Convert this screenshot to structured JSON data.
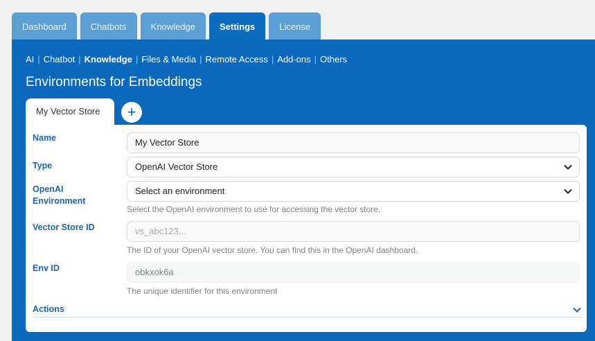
{
  "tabs": [
    {
      "label": "Dashboard",
      "active": false
    },
    {
      "label": "Chatbots",
      "active": false
    },
    {
      "label": "Knowledge",
      "active": false
    },
    {
      "label": "Settings",
      "active": true
    },
    {
      "label": "License",
      "active": false
    }
  ],
  "subnav": [
    {
      "label": "AI",
      "active": false
    },
    {
      "label": "Chatbot",
      "active": false
    },
    {
      "label": "Knowledge",
      "active": true
    },
    {
      "label": "Files & Media",
      "active": false
    },
    {
      "label": "Remote Access",
      "active": false
    },
    {
      "label": "Add-ons",
      "active": false
    },
    {
      "label": "Others",
      "active": false
    }
  ],
  "separator": "|",
  "heading": "Environments for Embeddings",
  "env_tab": {
    "label": "My Vector Store"
  },
  "add_button": {
    "icon": "plus-icon",
    "glyph": "+"
  },
  "form": {
    "name": {
      "label": "Name",
      "value": "My Vector Store"
    },
    "type": {
      "label": "Type",
      "value": "OpenAI Vector Store"
    },
    "openai_environment": {
      "label_line1": "OpenAI",
      "label_line2": "Environment",
      "value": "Select an environment",
      "help": "Select the OpenAI environment to use for accessing the vector store."
    },
    "vector_store_id": {
      "label": "Vector Store ID",
      "placeholder": "vs_abc123...",
      "help": "The ID of your OpenAI vector store. You can find this in the OpenAI dashboard."
    },
    "env_id": {
      "label": "Env ID",
      "value": "obkxok6a",
      "help": "The unique identifier for this environment"
    },
    "actions": {
      "label": "Actions"
    }
  },
  "colors": {
    "brand": "#0b69bd",
    "tab_inactive": "#5b9fd3",
    "label": "#1f64a8",
    "page_bg": "#f0f0f1"
  }
}
